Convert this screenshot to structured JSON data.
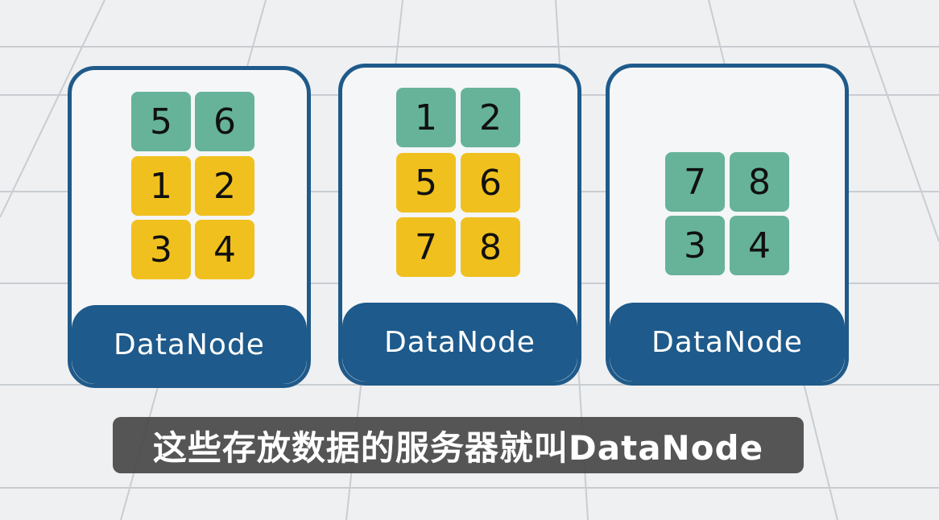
{
  "nodes": [
    {
      "label": "DataNode",
      "blocks": [
        {
          "text": "5",
          "color": "green"
        },
        {
          "text": "6",
          "color": "green"
        },
        {
          "text": "1",
          "color": "yellow"
        },
        {
          "text": "2",
          "color": "yellow"
        },
        {
          "text": "3",
          "color": "yellow"
        },
        {
          "text": "4",
          "color": "yellow"
        }
      ]
    },
    {
      "label": "DataNode",
      "blocks": [
        {
          "text": "1",
          "color": "green"
        },
        {
          "text": "2",
          "color": "green"
        },
        {
          "text": "5",
          "color": "yellow"
        },
        {
          "text": "6",
          "color": "yellow"
        },
        {
          "text": "7",
          "color": "yellow"
        },
        {
          "text": "8",
          "color": "yellow"
        }
      ]
    },
    {
      "label": "DataNode",
      "blocks": [
        {
          "text": "7",
          "color": "green"
        },
        {
          "text": "8",
          "color": "green"
        },
        {
          "text": "3",
          "color": "green"
        },
        {
          "text": "4",
          "color": "green"
        }
      ]
    }
  ],
  "caption": "这些存放数据的服务器就叫DataNode",
  "colors": {
    "node_border": "#1f5a8a",
    "node_footer": "#1e5a8b",
    "block_green": "#66b39a",
    "block_yellow": "#f0c01e",
    "background": "#eef0f2",
    "grid_line": "#c9cdd1"
  }
}
